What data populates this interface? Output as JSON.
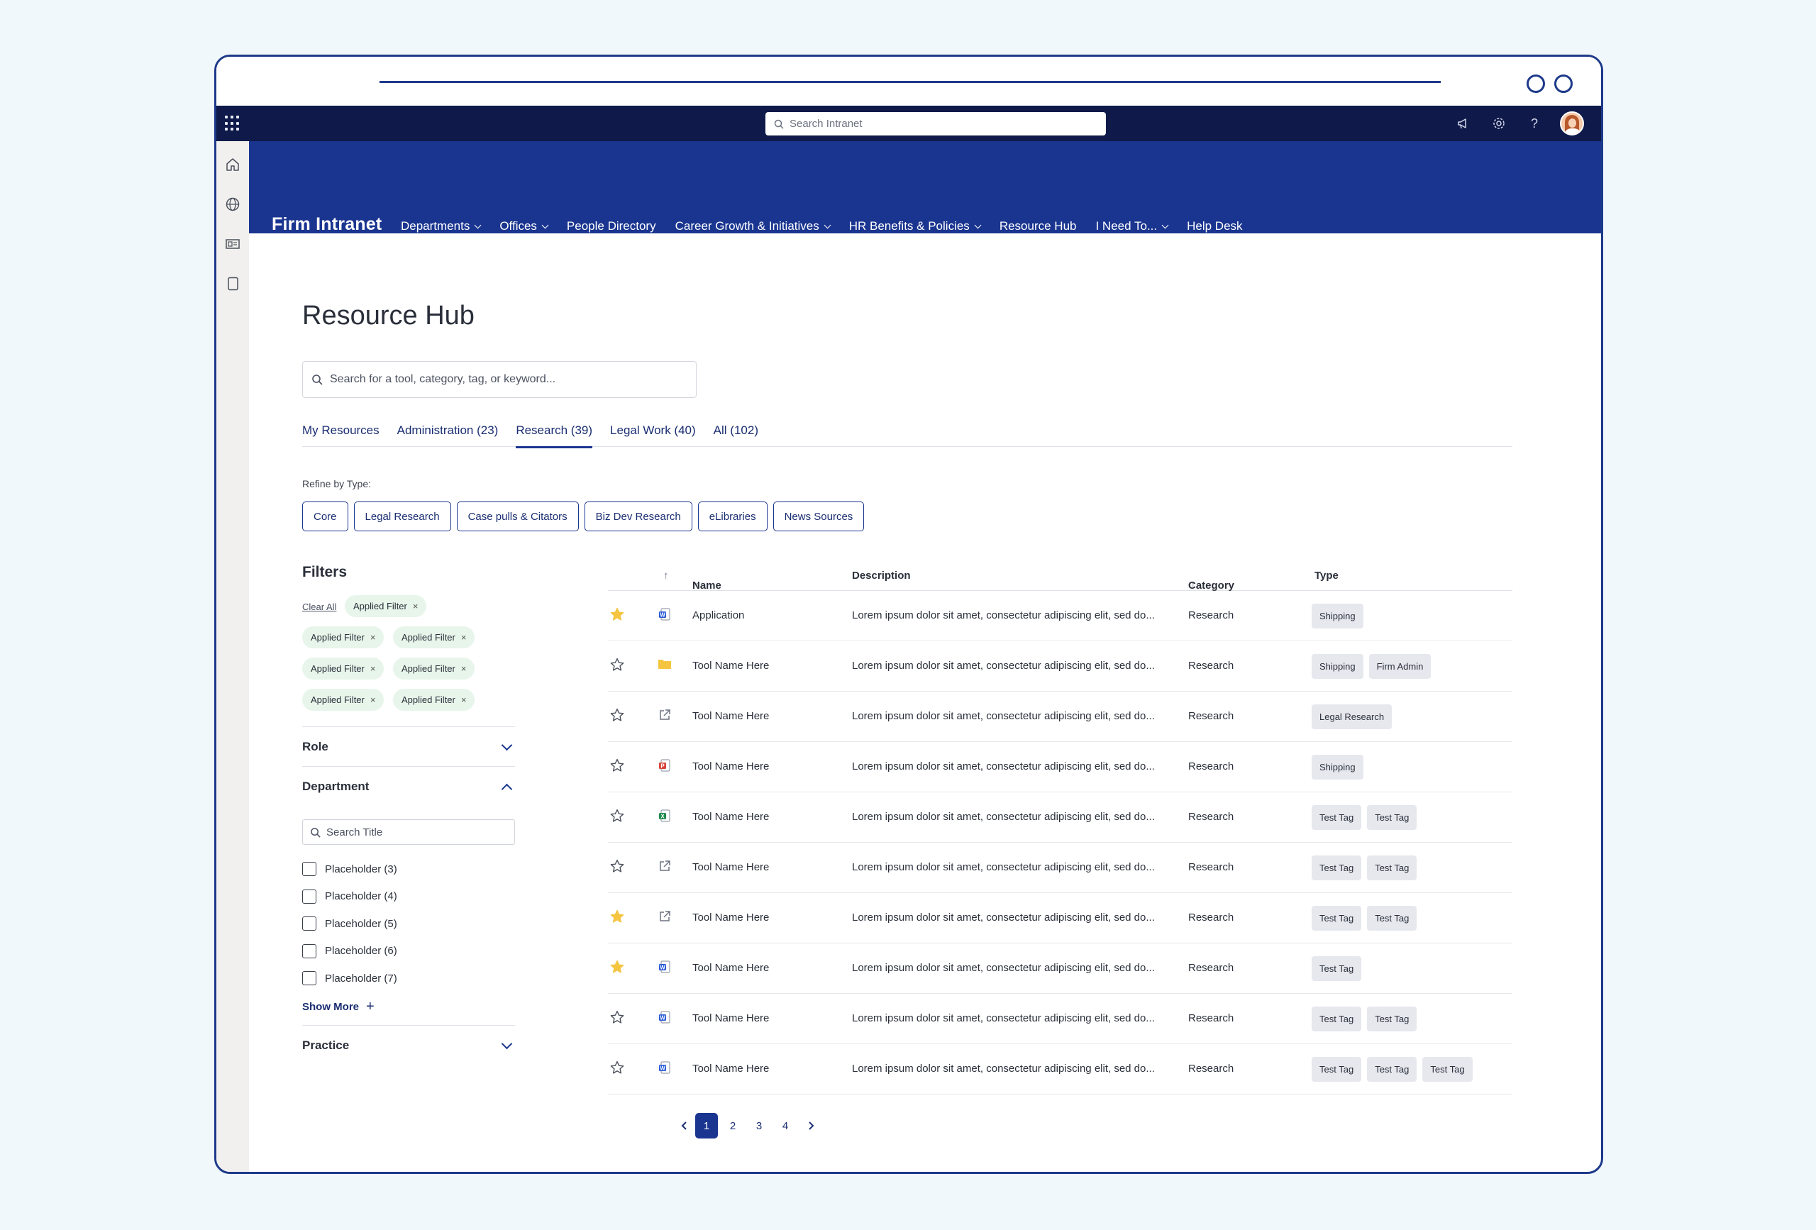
{
  "suite": {
    "search_placeholder": "Search Intranet",
    "icons": [
      "megaphone-icon",
      "gear-icon",
      "help-icon",
      "avatar"
    ]
  },
  "leftrail": {
    "icons": [
      "home-icon",
      "globe-icon",
      "news-icon",
      "document-icon"
    ]
  },
  "appbar": {
    "brand": "Firm Intranet",
    "nav": [
      {
        "label": "Departments",
        "dropdown": true
      },
      {
        "label": "Offices",
        "dropdown": true
      },
      {
        "label": "People Directory",
        "dropdown": false
      },
      {
        "label": "Career Growth & Initiatives",
        "dropdown": true
      },
      {
        "label": "HR Benefits & Policies",
        "dropdown": true
      },
      {
        "label": "Resource Hub",
        "dropdown": false
      },
      {
        "label": "I Need To...",
        "dropdown": true
      },
      {
        "label": "Help Desk",
        "dropdown": false
      }
    ]
  },
  "page": {
    "title": "Resource Hub",
    "search_placeholder": "Search for a tool, category, tag, or keyword..."
  },
  "tabs": [
    {
      "label": "My Resources",
      "active": false
    },
    {
      "label": "Administration (23)",
      "active": false
    },
    {
      "label": "Research  (39)",
      "active": true
    },
    {
      "label": "Legal Work  (40)",
      "active": false
    },
    {
      "label": "All (102)",
      "active": false
    }
  ],
  "refine": {
    "label": "Refine by Type:",
    "chips": [
      "Core",
      "Legal Research",
      "Case pulls & Citators",
      "Biz Dev Research",
      "eLibraries",
      "News Sources"
    ]
  },
  "filters": {
    "title": "Filters",
    "clear_all": "Clear All",
    "applied": [
      "Applied Filter",
      "Applied Filter",
      "Applied Filter",
      "Applied Filter",
      "Applied Filter",
      "Applied Filter",
      "Applied Filter"
    ],
    "role_label": "Role",
    "department_label": "Department",
    "department_search_placeholder": "Search Title",
    "department_options": [
      "Placeholder (3)",
      "Placeholder (4)",
      "Placeholder (5)",
      "Placeholder (6)",
      "Placeholder (7)"
    ],
    "show_more": "Show More",
    "practice_label": "Practice"
  },
  "table": {
    "headers": {
      "sort": "↑",
      "name": "Name",
      "description": "Description",
      "category": "Category",
      "type": "Type"
    },
    "rows": [
      {
        "starred": true,
        "icon": "word-doc-icon",
        "name": "Application",
        "description": "Lorem ipsum dolor sit amet, consectetur adipiscing elit, sed do...",
        "category": "Research",
        "tags": [
          "Shipping"
        ]
      },
      {
        "starred": false,
        "icon": "folder-icon",
        "name": "Tool Name Here",
        "description": "Lorem ipsum dolor sit amet, consectetur adipiscing elit, sed do...",
        "category": "Research",
        "tags": [
          "Shipping",
          "Firm Admin"
        ]
      },
      {
        "starred": false,
        "icon": "external-link-icon",
        "name": "Tool Name Here",
        "description": "Lorem ipsum dolor sit amet, consectetur adipiscing elit, sed do...",
        "category": "Research",
        "tags": [
          "Legal Research"
        ]
      },
      {
        "starred": false,
        "icon": "pdf-icon",
        "name": "Tool Name Here",
        "description": "Lorem ipsum dolor sit amet, consectetur adipiscing elit, sed do...",
        "category": "Research",
        "tags": [
          "Shipping"
        ]
      },
      {
        "starred": false,
        "icon": "excel-icon",
        "name": "Tool Name Here",
        "description": "Lorem ipsum dolor sit amet, consectetur adipiscing elit, sed do...",
        "category": "Research",
        "tags": [
          "Test Tag",
          "Test Tag"
        ]
      },
      {
        "starred": false,
        "icon": "external-link-icon",
        "name": "Tool Name Here",
        "description": "Lorem ipsum dolor sit amet, consectetur adipiscing elit, sed do...",
        "category": "Research",
        "tags": [
          "Test Tag",
          "Test Tag"
        ]
      },
      {
        "starred": true,
        "icon": "external-link-icon",
        "name": "Tool Name Here",
        "description": "Lorem ipsum dolor sit amet, consectetur adipiscing elit, sed do...",
        "category": "Research",
        "tags": [
          "Test Tag",
          "Test Tag"
        ]
      },
      {
        "starred": true,
        "icon": "word-doc-icon",
        "name": "Tool Name Here",
        "description": "Lorem ipsum dolor sit amet, consectetur adipiscing elit, sed do...",
        "category": "Research",
        "tags": [
          "Test Tag"
        ]
      },
      {
        "starred": false,
        "icon": "word-doc-icon",
        "name": "Tool Name Here",
        "description": "Lorem ipsum dolor sit amet, consectetur adipiscing elit, sed do...",
        "category": "Research",
        "tags": [
          "Test Tag",
          "Test Tag"
        ]
      },
      {
        "starred": false,
        "icon": "word-doc-icon",
        "name": "Tool Name Here",
        "description": "Lorem ipsum dolor sit amet, consectetur adipiscing elit, sed do...",
        "category": "Research",
        "tags": [
          "Test Tag",
          "Test Tag",
          "Test Tag"
        ]
      }
    ]
  },
  "pagination": {
    "pages": [
      "1",
      "2",
      "3",
      "4"
    ],
    "current": "1"
  },
  "colors": {
    "navy": "#1a3590",
    "suitebar": "#0f1a4a",
    "star_filled": "#f5c542",
    "chip_green": "#e7f5ea"
  }
}
